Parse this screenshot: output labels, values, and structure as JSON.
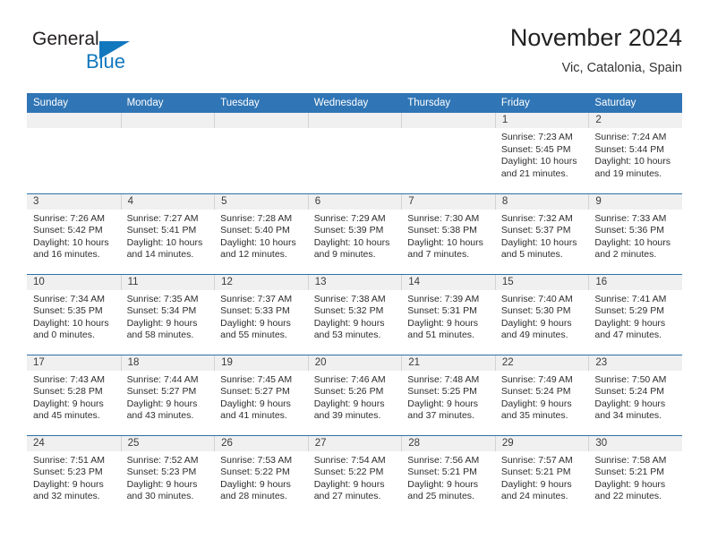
{
  "logo": {
    "word1": "General",
    "word2": "Blue",
    "flag_icon": "triangle-flag-icon",
    "color_dark": "#231f20",
    "color_blue": "#1278be"
  },
  "header": {
    "title": "November 2024",
    "subtitle": "Vic, Catalonia, Spain"
  },
  "theme": {
    "header_bg": "#3075b5",
    "header_text": "#ffffff",
    "row_border": "#2f6fa8",
    "daynum_bg": "#f0f0f0",
    "cell_text": "#2e2e2e"
  },
  "weekdays": [
    "Sunday",
    "Monday",
    "Tuesday",
    "Wednesday",
    "Thursday",
    "Friday",
    "Saturday"
  ],
  "weeks": [
    [
      {
        "empty": true
      },
      {
        "empty": true
      },
      {
        "empty": true
      },
      {
        "empty": true
      },
      {
        "empty": true
      },
      {
        "day": "1",
        "sunrise": "Sunrise: 7:23 AM",
        "sunset": "Sunset: 5:45 PM",
        "daylight1": "Daylight: 10 hours",
        "daylight2": "and 21 minutes."
      },
      {
        "day": "2",
        "sunrise": "Sunrise: 7:24 AM",
        "sunset": "Sunset: 5:44 PM",
        "daylight1": "Daylight: 10 hours",
        "daylight2": "and 19 minutes."
      }
    ],
    [
      {
        "day": "3",
        "sunrise": "Sunrise: 7:26 AM",
        "sunset": "Sunset: 5:42 PM",
        "daylight1": "Daylight: 10 hours",
        "daylight2": "and 16 minutes."
      },
      {
        "day": "4",
        "sunrise": "Sunrise: 7:27 AM",
        "sunset": "Sunset: 5:41 PM",
        "daylight1": "Daylight: 10 hours",
        "daylight2": "and 14 minutes."
      },
      {
        "day": "5",
        "sunrise": "Sunrise: 7:28 AM",
        "sunset": "Sunset: 5:40 PM",
        "daylight1": "Daylight: 10 hours",
        "daylight2": "and 12 minutes."
      },
      {
        "day": "6",
        "sunrise": "Sunrise: 7:29 AM",
        "sunset": "Sunset: 5:39 PM",
        "daylight1": "Daylight: 10 hours",
        "daylight2": "and 9 minutes."
      },
      {
        "day": "7",
        "sunrise": "Sunrise: 7:30 AM",
        "sunset": "Sunset: 5:38 PM",
        "daylight1": "Daylight: 10 hours",
        "daylight2": "and 7 minutes."
      },
      {
        "day": "8",
        "sunrise": "Sunrise: 7:32 AM",
        "sunset": "Sunset: 5:37 PM",
        "daylight1": "Daylight: 10 hours",
        "daylight2": "and 5 minutes."
      },
      {
        "day": "9",
        "sunrise": "Sunrise: 7:33 AM",
        "sunset": "Sunset: 5:36 PM",
        "daylight1": "Daylight: 10 hours",
        "daylight2": "and 2 minutes."
      }
    ],
    [
      {
        "day": "10",
        "sunrise": "Sunrise: 7:34 AM",
        "sunset": "Sunset: 5:35 PM",
        "daylight1": "Daylight: 10 hours",
        "daylight2": "and 0 minutes."
      },
      {
        "day": "11",
        "sunrise": "Sunrise: 7:35 AM",
        "sunset": "Sunset: 5:34 PM",
        "daylight1": "Daylight: 9 hours",
        "daylight2": "and 58 minutes."
      },
      {
        "day": "12",
        "sunrise": "Sunrise: 7:37 AM",
        "sunset": "Sunset: 5:33 PM",
        "daylight1": "Daylight: 9 hours",
        "daylight2": "and 55 minutes."
      },
      {
        "day": "13",
        "sunrise": "Sunrise: 7:38 AM",
        "sunset": "Sunset: 5:32 PM",
        "daylight1": "Daylight: 9 hours",
        "daylight2": "and 53 minutes."
      },
      {
        "day": "14",
        "sunrise": "Sunrise: 7:39 AM",
        "sunset": "Sunset: 5:31 PM",
        "daylight1": "Daylight: 9 hours",
        "daylight2": "and 51 minutes."
      },
      {
        "day": "15",
        "sunrise": "Sunrise: 7:40 AM",
        "sunset": "Sunset: 5:30 PM",
        "daylight1": "Daylight: 9 hours",
        "daylight2": "and 49 minutes."
      },
      {
        "day": "16",
        "sunrise": "Sunrise: 7:41 AM",
        "sunset": "Sunset: 5:29 PM",
        "daylight1": "Daylight: 9 hours",
        "daylight2": "and 47 minutes."
      }
    ],
    [
      {
        "day": "17",
        "sunrise": "Sunrise: 7:43 AM",
        "sunset": "Sunset: 5:28 PM",
        "daylight1": "Daylight: 9 hours",
        "daylight2": "and 45 minutes."
      },
      {
        "day": "18",
        "sunrise": "Sunrise: 7:44 AM",
        "sunset": "Sunset: 5:27 PM",
        "daylight1": "Daylight: 9 hours",
        "daylight2": "and 43 minutes."
      },
      {
        "day": "19",
        "sunrise": "Sunrise: 7:45 AM",
        "sunset": "Sunset: 5:27 PM",
        "daylight1": "Daylight: 9 hours",
        "daylight2": "and 41 minutes."
      },
      {
        "day": "20",
        "sunrise": "Sunrise: 7:46 AM",
        "sunset": "Sunset: 5:26 PM",
        "daylight1": "Daylight: 9 hours",
        "daylight2": "and 39 minutes."
      },
      {
        "day": "21",
        "sunrise": "Sunrise: 7:48 AM",
        "sunset": "Sunset: 5:25 PM",
        "daylight1": "Daylight: 9 hours",
        "daylight2": "and 37 minutes."
      },
      {
        "day": "22",
        "sunrise": "Sunrise: 7:49 AM",
        "sunset": "Sunset: 5:24 PM",
        "daylight1": "Daylight: 9 hours",
        "daylight2": "and 35 minutes."
      },
      {
        "day": "23",
        "sunrise": "Sunrise: 7:50 AM",
        "sunset": "Sunset: 5:24 PM",
        "daylight1": "Daylight: 9 hours",
        "daylight2": "and 34 minutes."
      }
    ],
    [
      {
        "day": "24",
        "sunrise": "Sunrise: 7:51 AM",
        "sunset": "Sunset: 5:23 PM",
        "daylight1": "Daylight: 9 hours",
        "daylight2": "and 32 minutes."
      },
      {
        "day": "25",
        "sunrise": "Sunrise: 7:52 AM",
        "sunset": "Sunset: 5:23 PM",
        "daylight1": "Daylight: 9 hours",
        "daylight2": "and 30 minutes."
      },
      {
        "day": "26",
        "sunrise": "Sunrise: 7:53 AM",
        "sunset": "Sunset: 5:22 PM",
        "daylight1": "Daylight: 9 hours",
        "daylight2": "and 28 minutes."
      },
      {
        "day": "27",
        "sunrise": "Sunrise: 7:54 AM",
        "sunset": "Sunset: 5:22 PM",
        "daylight1": "Daylight: 9 hours",
        "daylight2": "and 27 minutes."
      },
      {
        "day": "28",
        "sunrise": "Sunrise: 7:56 AM",
        "sunset": "Sunset: 5:21 PM",
        "daylight1": "Daylight: 9 hours",
        "daylight2": "and 25 minutes."
      },
      {
        "day": "29",
        "sunrise": "Sunrise: 7:57 AM",
        "sunset": "Sunset: 5:21 PM",
        "daylight1": "Daylight: 9 hours",
        "daylight2": "and 24 minutes."
      },
      {
        "day": "30",
        "sunrise": "Sunrise: 7:58 AM",
        "sunset": "Sunset: 5:21 PM",
        "daylight1": "Daylight: 9 hours",
        "daylight2": "and 22 minutes."
      }
    ]
  ]
}
